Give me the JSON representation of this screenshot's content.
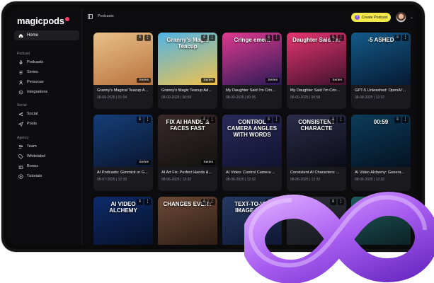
{
  "app": {
    "name": "magicpods"
  },
  "sidebar": {
    "home": "Home",
    "sections": [
      {
        "label": "Podcast",
        "items": [
          "Podcasts",
          "Series",
          "Personas",
          "Integrations"
        ]
      },
      {
        "label": "Social",
        "items": [
          "Social",
          "Posts"
        ]
      },
      {
        "label": "Agency",
        "items": [
          "Team",
          "Whitelabel",
          "Bonus",
          "Tutorials"
        ]
      }
    ]
  },
  "topbar": {
    "breadcrumb": "Podcasts",
    "create_label": "Create Podcast"
  },
  "cards": [
    {
      "title": "Granny's Magical Teacup A...",
      "meta": "08-09-2025 | 01:04",
      "badge": "Series",
      "thumb_text": "",
      "colors": [
        "#e9c08a",
        "#b8733e"
      ]
    },
    {
      "title": "Granny's Magic Teacup Ad...",
      "meta": "08-09-2025 | 00:59",
      "badge": "Series",
      "thumb_text": "Granny's Magic Teacup",
      "colors": [
        "#4fb3e8",
        "#f1c24a"
      ]
    },
    {
      "title": "My Daughter Said I'm Crin...",
      "meta": "08-09-2025 | 00:36",
      "badge": "Series",
      "thumb_text": "Cringe ement",
      "colors": [
        "#e13a8e",
        "#2b1a56"
      ]
    },
    {
      "title": "My Daughter Said I'm Crin...",
      "meta": "08-09-2025 | 00:58",
      "badge": "Series",
      "thumb_text": "Daughter Said I'm",
      "colors": [
        "#e7356f",
        "#40122d"
      ]
    },
    {
      "title": "GPT-5 Unleashed: OpenAI'...",
      "meta": "08-08-2025 | 12:32",
      "badge": "",
      "thumb_text": "-5 ASHED",
      "colors": [
        "#145a88",
        "#061a33"
      ]
    },
    {
      "title": "AI Podcasts: Gimmick or G...",
      "meta": "08-07-2025 | 12:33",
      "badge": "Series",
      "thumb_text": "",
      "colors": [
        "#163e78",
        "#0a1630"
      ]
    },
    {
      "title": "AI Art Fix: Perfect Hands &...",
      "meta": "08-06-2025 | 12:32",
      "badge": "Series",
      "thumb_text": "FIX AI HANDS & FACES FAST",
      "colors": [
        "#3a2a2a",
        "#111111"
      ]
    },
    {
      "title": "AI Video: Control Camera ...",
      "meta": "08-06-2025 | 12:32",
      "badge": "",
      "thumb_text": "CONTROL CAMERA ANGLES WITH WORDS",
      "colors": [
        "#2a2a5a",
        "#121230"
      ]
    },
    {
      "title": "Consistent AI Characters: ...",
      "meta": "08-06-2025 | 12:32",
      "badge": "",
      "thumb_text": "CONSISTENT CHARACTE",
      "colors": [
        "#2b2d4a",
        "#0b0c18"
      ]
    },
    {
      "title": "AI Video Alchemy: Genera...",
      "meta": "08-06-2025 | 12:32",
      "badge": "",
      "thumb_text": "00:59",
      "colors": [
        "#0d3c5a",
        "#041222"
      ]
    },
    {
      "title": "",
      "meta": "",
      "badge": "",
      "thumb_text": "AI VIDEO ALCHEMY",
      "colors": [
        "#0e2b6a",
        "#061026"
      ]
    },
    {
      "title": "",
      "meta": "",
      "badge": "",
      "thumb_text": "CHANGES EVERY",
      "colors": [
        "#6d4a37",
        "#2a1a12"
      ]
    },
    {
      "title": "",
      "meta": "",
      "badge": "",
      "thumb_text": "TEXT-TO-VID IMAGE-TO-V",
      "colors": [
        "#263a63",
        "#0d1530"
      ]
    },
    {
      "title": "",
      "meta": "",
      "badge": "",
      "thumb_text": "",
      "colors": [
        "#2f2f3a",
        "#15151b"
      ]
    },
    {
      "title": "",
      "meta": "",
      "badge": "",
      "thumb_text": "",
      "colors": [
        "#1f5a5a",
        "#0b1e22"
      ]
    }
  ]
}
